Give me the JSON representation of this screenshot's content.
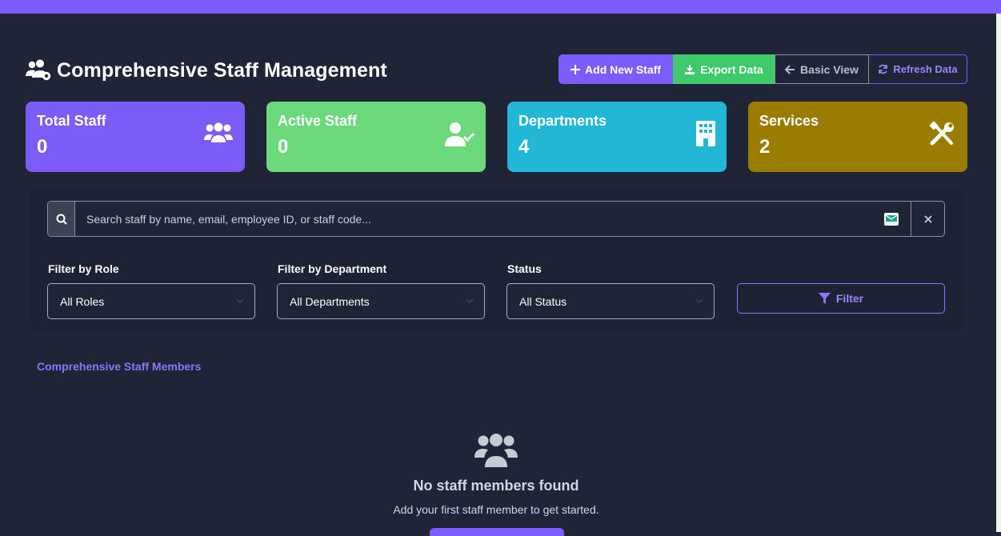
{
  "header": {
    "title": "Comprehensive Staff Management",
    "icon": "users-cog-icon"
  },
  "actions": {
    "add": "Add New Staff",
    "export": "Export Data",
    "basic": "Basic View",
    "refresh": "Refresh Data"
  },
  "stats": [
    {
      "label": "Total Staff",
      "value": "0",
      "icon": "users-icon",
      "color": "#7b5cf6"
    },
    {
      "label": "Active Staff",
      "value": "0",
      "icon": "user-check-icon",
      "color": "#6bd97c"
    },
    {
      "label": "Departments",
      "value": "4",
      "icon": "building-icon",
      "color": "#22b7d6"
    },
    {
      "label": "Services",
      "value": "2",
      "icon": "tools-icon",
      "color": "#997c00"
    }
  ],
  "search": {
    "placeholder": "Search staff by name, email, employee ID, or staff code..."
  },
  "filters": {
    "role": {
      "label": "Filter by Role",
      "value": "All Roles"
    },
    "department": {
      "label": "Filter by Department",
      "value": "All Departments"
    },
    "status": {
      "label": "Status",
      "value": "All Status"
    },
    "button": "Filter"
  },
  "list": {
    "title": "Comprehensive Staff Members",
    "empty_title": "No staff members found",
    "empty_sub": "Add your first staff member to get started."
  },
  "colors": {
    "accent": "#7c5cff",
    "success": "#3ec96b",
    "background": "#1f2536"
  }
}
